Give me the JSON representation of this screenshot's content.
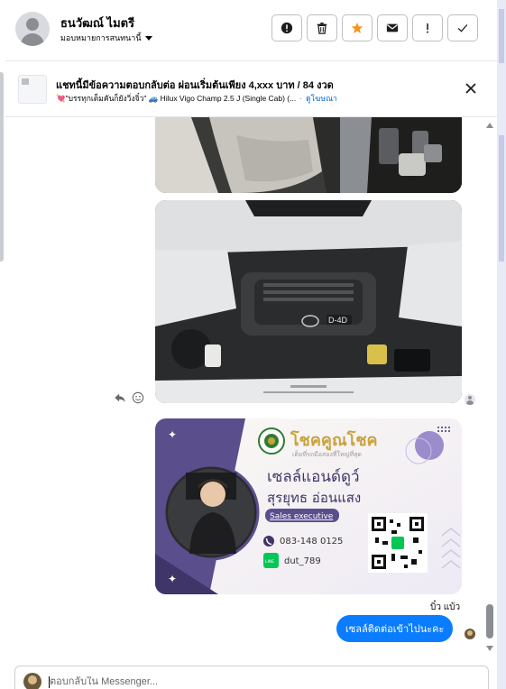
{
  "header": {
    "contact_name": "ธนวัฒณ์ ไมตรี",
    "assign_label": "มอบหมายการสนทนานี้",
    "actions": [
      {
        "name": "report-button",
        "icon": "alert-circle-icon"
      },
      {
        "name": "delete-button",
        "icon": "trash-icon"
      },
      {
        "name": "star-button",
        "icon": "star-icon"
      },
      {
        "name": "mark-unread-button",
        "icon": "envelope-icon"
      },
      {
        "name": "flag-button",
        "icon": "exclamation-icon"
      },
      {
        "name": "done-button",
        "icon": "check-icon"
      }
    ]
  },
  "topic": {
    "title": "แชทนี้มีข้อความตอบกลับต่อ ผ่อนเริ่มต้นเพียง 4,xxx บาท / 84 งวด",
    "subtitle_page": "💘\"บรรทุกเต็มคันก็ยังวิ่งจิ๋ว\" 🚙 Hilux Vigo Champ 2.5 J (Single Cab) (...",
    "subtitle_link": "ดูโฆษณา",
    "close_icon": "close-icon"
  },
  "conversation": {
    "business_card": {
      "brand": "โชคคูณโชค",
      "tagline": "เต็มที่รถมือสองที่ใหญ่ที่สุด",
      "heading": "เซลล์แอนด์ดูว์",
      "person_name": "สุรยุทธ อ่อนแสง",
      "role": "Sales executive",
      "phone": "083-148 0125",
      "line_badge": "LINE",
      "line_id": "dut_789"
    },
    "engine_badge": "D-4D",
    "sender_label": "บิ๋ว แบ้ว",
    "message": "เซลล์ติดต่อเข้าไปนะคะ"
  },
  "composer": {
    "placeholder": "ตอบกลับใน Messenger..."
  },
  "colors": {
    "accent": "#0a7cff",
    "star": "#f7931e",
    "card_purple": "#5a4e8c",
    "card_gold": "#c8a33c"
  }
}
